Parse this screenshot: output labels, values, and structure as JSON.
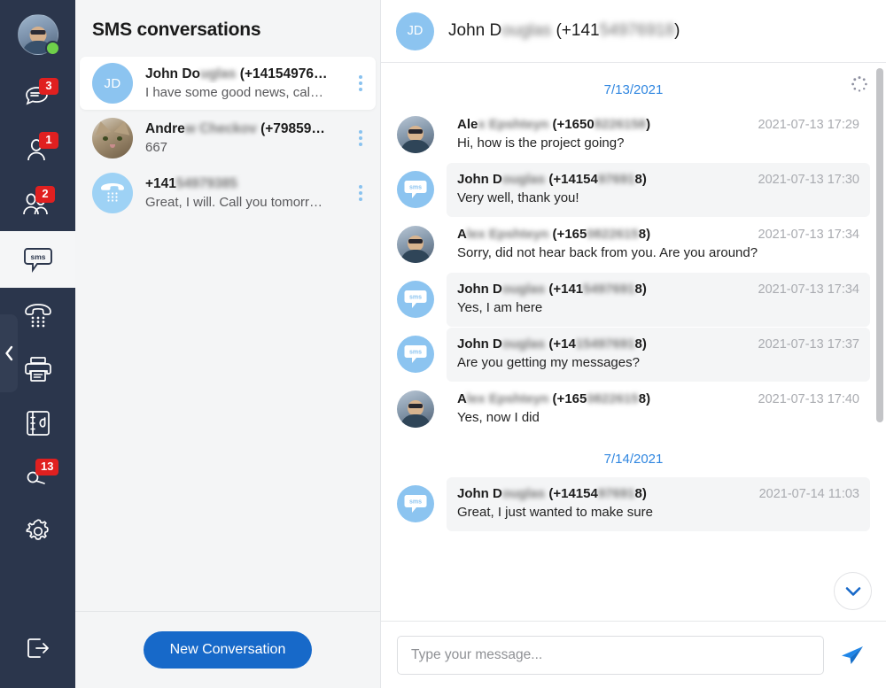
{
  "rail": {
    "avatar": {
      "name": "user-avatar",
      "status": "online"
    },
    "items": [
      {
        "icon": "chat-bubble-icon",
        "label": "Chats",
        "badge": "3"
      },
      {
        "icon": "person-icon",
        "label": "Contacts",
        "badge": "1"
      },
      {
        "icon": "people-icon",
        "label": "Groups",
        "badge": "2"
      },
      {
        "icon": "sms-icon",
        "label": "SMS",
        "badge": ""
      },
      {
        "icon": "dialpad-phone-icon",
        "label": "Dialpad",
        "badge": ""
      },
      {
        "icon": "printer-icon",
        "label": "Fax",
        "badge": ""
      },
      {
        "icon": "voicemail-icon",
        "label": "Voicemail",
        "badge": ""
      },
      {
        "icon": "search-icon",
        "label": "Search",
        "badge": "13"
      },
      {
        "icon": "gear-icon",
        "label": "Settings",
        "badge": ""
      }
    ],
    "logout": {
      "icon": "logout-icon",
      "label": "Log out"
    },
    "collapse": {
      "icon": "chevron-left-icon",
      "label": "Collapse"
    }
  },
  "conversations": {
    "title": "SMS conversations",
    "new_button": "New Conversation",
    "menu_icon": "more-vertical-icon",
    "items": [
      {
        "avatar_type": "initials",
        "initials": "JD",
        "name_visible": "John Do",
        "name_blurred": "uglas",
        "name_suffix": " (+14154976…",
        "preview": "I have some good news, cal…",
        "active": true
      },
      {
        "avatar_type": "cat-photo",
        "initials": "",
        "name_visible": "Andre",
        "name_blurred": "w Checkov",
        "name_suffix": " (+79859…",
        "preview": "667",
        "active": false
      },
      {
        "avatar_type": "phone",
        "initials": "",
        "name_visible": "+141",
        "name_blurred": "54979385",
        "name_suffix": "",
        "preview": "Great, I will. Call you tomorr…",
        "active": false
      }
    ]
  },
  "chat": {
    "header": {
      "avatar_initials": "JD",
      "name_visible": "John D",
      "name_blurred": "ouglas",
      "number_prefix": " (+141",
      "number_blurred": "54976918",
      "number_suffix": ")"
    },
    "spinner_icon": "loading-spinner-icon",
    "scroll_down_icon": "chevron-down-icon",
    "send_icon": "send-paper-plane-icon",
    "composer_placeholder": "Type your message...",
    "composer_value": "",
    "groups": [
      {
        "date": "7/13/2021",
        "messages": [
          {
            "avatar": "photo",
            "sender_visible": "Ale",
            "sender_blurred": "x Epshteyn",
            "number_prefix": " (+1650",
            "number_blurred": "8226158",
            "number_suffix": ")",
            "time": "2021-07-13 17:29",
            "text": "Hi, how is the project going?",
            "shaded": false
          },
          {
            "avatar": "sms",
            "sender_visible": "John D",
            "sender_blurred": "ouglas",
            "number_prefix": " (+14154",
            "number_blurred": "97691",
            "number_suffix": "8)",
            "time": "2021-07-13 17:30",
            "text": "Very well, thank you!",
            "shaded": true
          },
          {
            "avatar": "photo",
            "sender_visible": "A",
            "sender_blurred": "lex Epshteyn",
            "number_prefix": " (+165",
            "number_blurred": "0822615",
            "number_suffix": "8)",
            "time": "2021-07-13 17:34",
            "text": "Sorry, did not hear back from you. Are you around?",
            "shaded": false
          },
          {
            "avatar": "sms",
            "sender_visible": "John D",
            "sender_blurred": "ouglas",
            "number_prefix": " (+141",
            "number_blurred": "5497691",
            "number_suffix": "8)",
            "time": "2021-07-13 17:34",
            "text": "Yes, I am here",
            "shaded": true
          },
          {
            "avatar": "sms",
            "sender_visible": "John D",
            "sender_blurred": "ouglas",
            "number_prefix": " (+14",
            "number_blurred": "15497691",
            "number_suffix": "8)",
            "time": "2021-07-13 17:37",
            "text": "Are you getting my messages?",
            "shaded": true
          },
          {
            "avatar": "photo",
            "sender_visible": "A",
            "sender_blurred": "lex Epshteyn",
            "number_prefix": " (+165",
            "number_blurred": "0822615",
            "number_suffix": "8)",
            "time": "2021-07-13 17:40",
            "text": "Yes, now I did",
            "shaded": false
          }
        ]
      },
      {
        "date": "7/14/2021",
        "messages": [
          {
            "avatar": "sms",
            "sender_visible": "John D",
            "sender_blurred": "ouglas",
            "number_prefix": " (+14154",
            "number_blurred": "97691",
            "number_suffix": "8)",
            "time": "2021-07-14 11:03",
            "text": "Great, I just wanted to make sure",
            "shaded": true
          }
        ]
      }
    ]
  },
  "colors": {
    "rail_bg": "#2b364c",
    "badge_red": "#e02020",
    "accent_blue": "#1769c9",
    "link_blue": "#2f86e0",
    "avatar_blue": "#8cc4f0",
    "panel_bg": "#f4f5f6"
  }
}
